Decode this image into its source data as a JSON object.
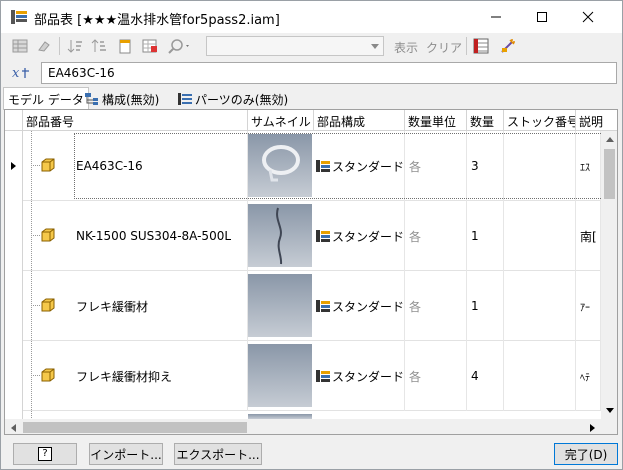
{
  "window": {
    "title": "部品表 [★★★温水排水管for5pass2.iam]",
    "minimize_icon": "minimize-icon",
    "maximize_icon": "maximize-icon",
    "close_icon": "close-icon"
  },
  "toolbar": {
    "view_combo_value": "",
    "show_label": "表示",
    "clear_label": "クリア"
  },
  "search": {
    "value": "EA463C-16"
  },
  "tabs": [
    {
      "label": "モデル データ"
    },
    {
      "label": "構成(無効)"
    },
    {
      "label": "パーツのみ(無効)"
    }
  ],
  "grid": {
    "columns": [
      "部品番号",
      "サムネイル",
      "部品構成",
      "数量単位",
      "数量",
      "ストック番号",
      "説明"
    ],
    "rows": [
      {
        "part_number": "EA463C-16",
        "structure": "スタンダード",
        "unit": "各",
        "qty": "3",
        "stock": "",
        "desc": "ｴｽ"
      },
      {
        "part_number": "NK-1500 SUS304-8A-500L",
        "structure": "スタンダード",
        "unit": "各",
        "qty": "1",
        "stock": "",
        "desc": "南["
      },
      {
        "part_number": "フレキ緩衝材",
        "structure": "スタンダード",
        "unit": "各",
        "qty": "1",
        "stock": "",
        "desc": "ｱｰ"
      },
      {
        "part_number": "フレキ緩衝材抑え",
        "structure": "スタンダード",
        "unit": "各",
        "qty": "4",
        "stock": "",
        "desc": "ﾍﾃ"
      }
    ]
  },
  "buttons": {
    "help_label": "?",
    "import_label": "インポート...",
    "export_label": "エクスポート...",
    "done_label": "完了(D)"
  }
}
